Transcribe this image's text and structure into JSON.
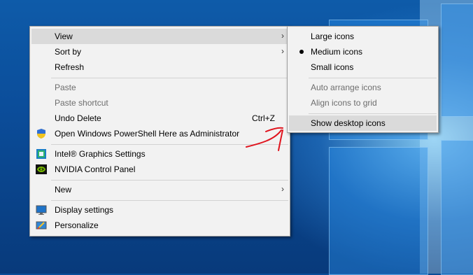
{
  "context_menu": {
    "items": [
      {
        "label": "View"
      },
      {
        "label": "Sort by"
      },
      {
        "label": "Refresh"
      },
      {
        "label": "Paste"
      },
      {
        "label": "Paste shortcut"
      },
      {
        "label": "Undo Delete",
        "shortcut": "Ctrl+Z"
      },
      {
        "label": "Open Windows PowerShell Here as Administrator"
      },
      {
        "label": "Intel® Graphics Settings"
      },
      {
        "label": "NVIDIA Control Panel"
      },
      {
        "label": "New"
      },
      {
        "label": "Display settings"
      },
      {
        "label": "Personalize"
      }
    ]
  },
  "view_submenu": {
    "items": [
      {
        "label": "Large icons"
      },
      {
        "label": "Medium icons",
        "selected": true
      },
      {
        "label": "Small icons"
      },
      {
        "label": "Auto arrange icons"
      },
      {
        "label": "Align icons to grid"
      },
      {
        "label": "Show desktop icons"
      }
    ]
  },
  "colors": {
    "menu_background": "#f2f2f2",
    "highlight": "#dadada",
    "disabled_text": "#6d6d6d",
    "annotation_red": "#e0141e"
  },
  "icons": {
    "shield": "uac-shield-icon",
    "intel": "intel-graphics-icon",
    "nvidia": "nvidia-icon",
    "display": "display-settings-icon",
    "personalize": "personalize-icon",
    "submenu_arrow": "chevron-right-icon"
  }
}
